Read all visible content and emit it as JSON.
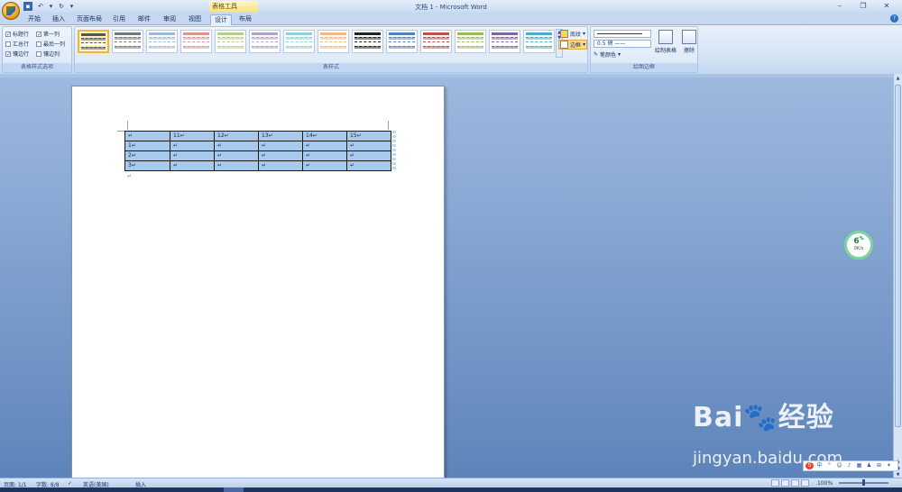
{
  "window": {
    "title": "文档 1 - Microsoft Word",
    "minimize_icon": "minimize-icon",
    "restore_icon": "restore-icon",
    "close_icon": "close-icon"
  },
  "quick_access": {
    "save_icon": "save-icon",
    "undo_icon": "undo-icon",
    "redo_icon": "redo-icon",
    "customize_icon": "dropdown-arrow-icon"
  },
  "contextual_tab_group": "表格工具",
  "tabs": [
    {
      "label": "开始"
    },
    {
      "label": "插入"
    },
    {
      "label": "页面布局"
    },
    {
      "label": "引用"
    },
    {
      "label": "邮件"
    },
    {
      "label": "审阅"
    },
    {
      "label": "视图"
    },
    {
      "label": "设计",
      "active": true
    },
    {
      "label": "布局"
    }
  ],
  "ribbon": {
    "style_options": {
      "group_label": "表格样式选项",
      "options": [
        {
          "label": "标题行",
          "checked": true
        },
        {
          "label": "第一列",
          "checked": true
        },
        {
          "label": "汇总行",
          "checked": false
        },
        {
          "label": "最后一列",
          "checked": false
        },
        {
          "label": "镶边行",
          "checked": true
        },
        {
          "label": "镶边列",
          "checked": false
        }
      ]
    },
    "table_styles": {
      "group_label": "表样式",
      "shading_label": "底纹",
      "borders_label": "边框",
      "swatch_colors": [
        "#555555",
        "#777777",
        "#9bbbd9",
        "#d99694",
        "#b5cf86",
        "#b3a2c7",
        "#8fd0e0",
        "#f6b880",
        "#222222",
        "#4f81bd",
        "#c0504d",
        "#9bbb59",
        "#8064a2",
        "#4bacc6"
      ]
    },
    "draw_borders": {
      "group_label": "绘图边框",
      "line_weight": "0.5 磅",
      "pen_color_label": "笔颜色",
      "draw_table_label": "绘制表格",
      "eraser_label": "擦除"
    }
  },
  "document": {
    "table": {
      "rows": [
        [
          "↵",
          "11↵",
          "12↵",
          "13↵",
          "14↵",
          "15↵"
        ],
        [
          "1↵",
          "↵",
          "↵",
          "↵",
          "↵",
          "↵"
        ],
        [
          "2↵",
          "↵",
          "↵",
          "↵",
          "↵",
          "↵"
        ],
        [
          "3↵",
          "↵",
          "↵",
          "↵",
          "↵",
          "↵"
        ]
      ]
    },
    "paragraph_mark": "↵"
  },
  "net_monitor": {
    "percent": "6",
    "percent_unit": "%",
    "speed": "0K/s"
  },
  "watermark": {
    "brand": "Bai🐾经验",
    "url": "jingyan.baidu.com"
  },
  "statusbar": {
    "page": "页面: 1/1",
    "words": "字数: 8/8",
    "language": "英语(美国)",
    "mode": "插入",
    "zoom": "100%"
  }
}
